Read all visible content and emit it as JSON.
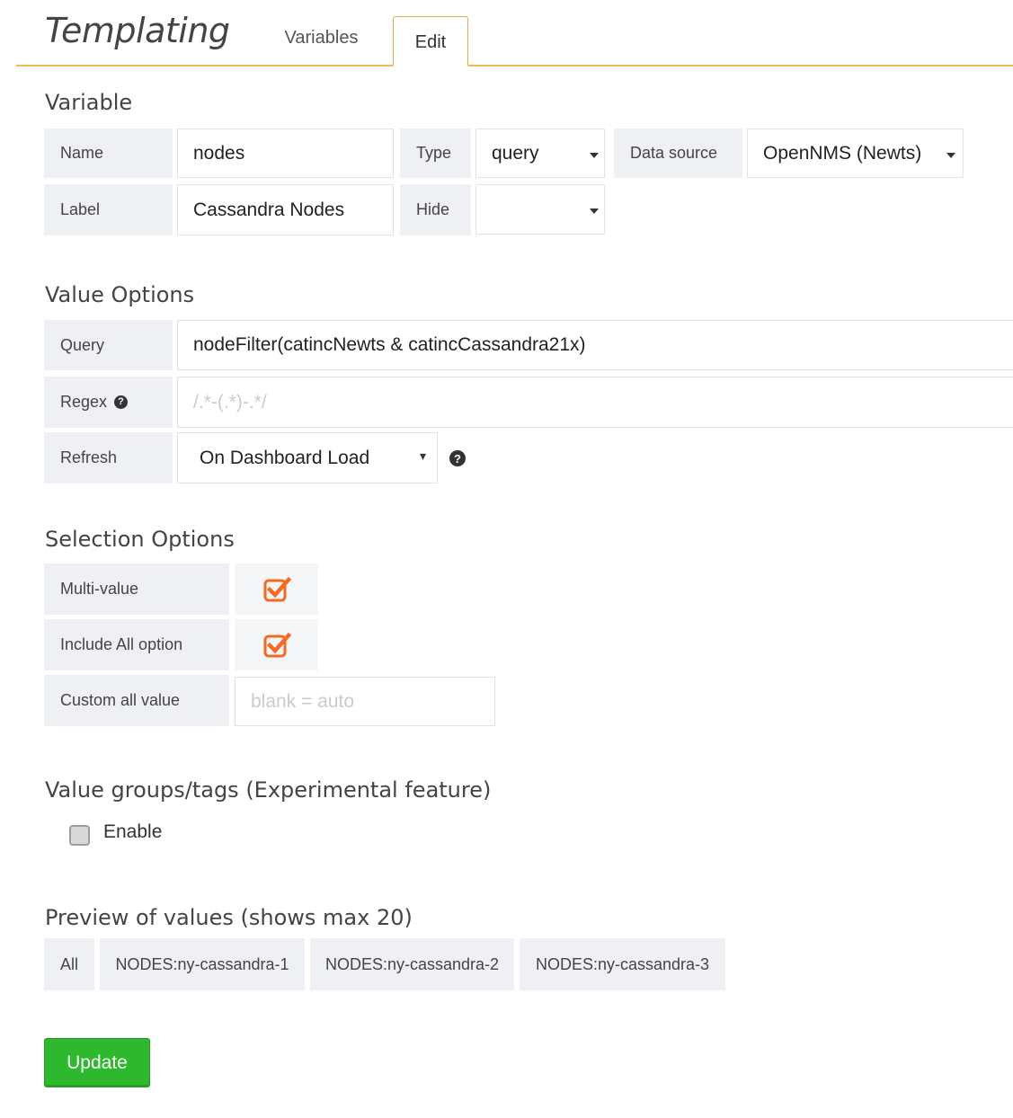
{
  "header": {
    "title": "Templating",
    "tabs": [
      {
        "label": "Variables",
        "active": false
      },
      {
        "label": "Edit",
        "active": true
      }
    ]
  },
  "variable": {
    "section_title": "Variable",
    "name_label": "Name",
    "name_value": "nodes",
    "type_label": "Type",
    "type_value": "query",
    "datasource_label": "Data source",
    "datasource_value": "OpenNMS (Newts)",
    "label_label": "Label",
    "label_value": "Cassandra Nodes",
    "hide_label": "Hide",
    "hide_value": ""
  },
  "value_options": {
    "section_title": "Value Options",
    "query_label": "Query",
    "query_value": "nodeFilter(catincNewts & catincCassandra21x)",
    "regex_label": "Regex",
    "regex_placeholder": "/.*-(.*)-.*/",
    "refresh_label": "Refresh",
    "refresh_value": "On Dashboard Load",
    "refresh_caret": "▾"
  },
  "selection_options": {
    "section_title": "Selection Options",
    "multi_value_label": "Multi-value",
    "multi_value_checked": true,
    "include_all_label": "Include All option",
    "include_all_checked": true,
    "custom_all_label": "Custom all value",
    "custom_all_placeholder": "blank = auto"
  },
  "value_groups": {
    "section_title": "Value groups/tags (Experimental feature)",
    "enable_label": "Enable",
    "enable_checked": false
  },
  "preview": {
    "section_title": "Preview of values (shows max 20)",
    "values": [
      "All",
      "NODES:ny-cassandra-1",
      "NODES:ny-cassandra-2",
      "NODES:ny-cassandra-3"
    ]
  },
  "actions": {
    "update_label": "Update"
  },
  "colors": {
    "accent_orange": "#f46a22",
    "header_underline": "#ecbb54",
    "update_green": "#2eb82e",
    "label_bg": "#eef0f4"
  },
  "icons": {
    "help": "question-circle-icon",
    "checkbox_checked": "checkbox-checked-icon"
  }
}
